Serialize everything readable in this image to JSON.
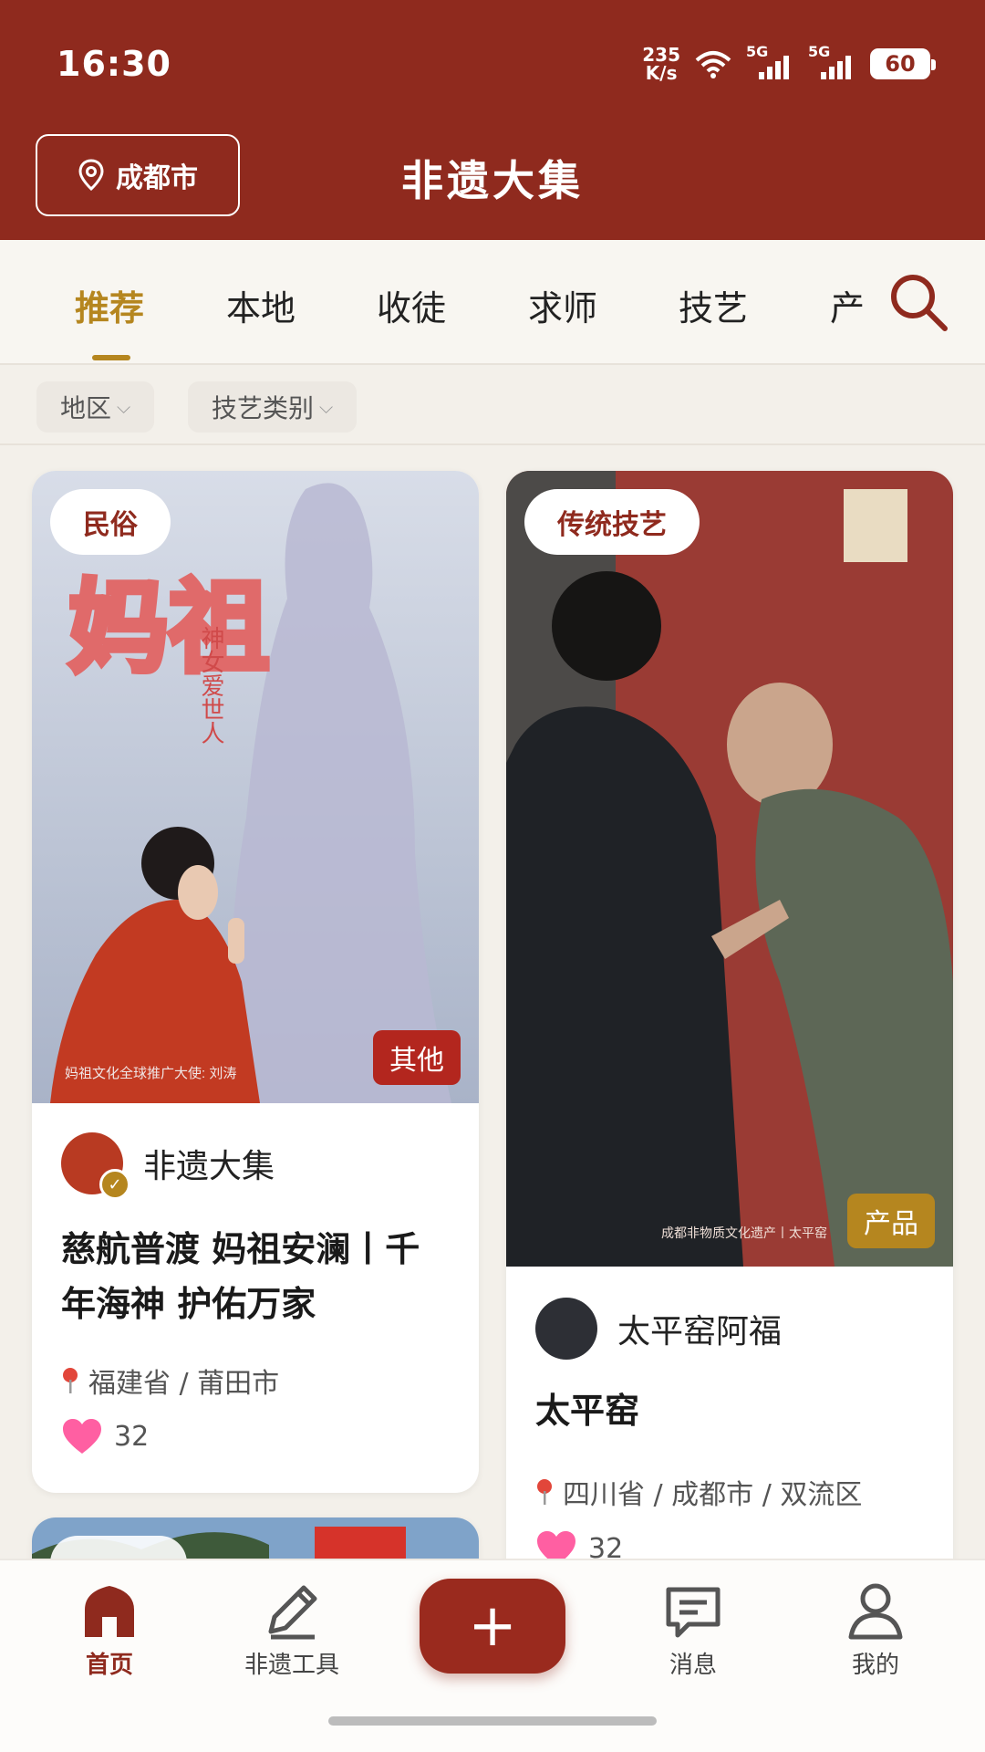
{
  "status_bar": {
    "time": "16:30",
    "net_speed_value": "235",
    "net_speed_unit": "K/s",
    "sig1": "5G",
    "sig2": "5G",
    "battery": "60"
  },
  "header": {
    "city": "成都市",
    "title": "非遗大集"
  },
  "tabs": [
    {
      "label": "推荐",
      "active": true
    },
    {
      "label": "本地"
    },
    {
      "label": "收徒"
    },
    {
      "label": "求师"
    },
    {
      "label": "技艺"
    },
    {
      "label": "产"
    }
  ],
  "filters": [
    {
      "label": "地区"
    },
    {
      "label": "技艺类别"
    }
  ],
  "cards": [
    {
      "tag": "民俗",
      "image_text_title": "妈祖",
      "image_text_vertical": "神女爱世人",
      "image_caption": "妈祖文化全球推广大使: 刘涛",
      "type_badge": "其他",
      "author": "非遗大集",
      "title": "慈航普渡 妈祖安澜丨千年海神 护佑万家",
      "location": "福建省 / 莆田市",
      "likes": "32"
    },
    {
      "tag": "传统技艺",
      "image_caption": "成都非物质文化遗产丨太平窑",
      "type_badge": "产品",
      "author": "太平窑阿福",
      "title": "太平窑",
      "location": "四川省 / 成都市 / 双流区",
      "likes": "32"
    }
  ],
  "bottom_nav": [
    {
      "label": "首页",
      "icon": "home-icon",
      "active": true
    },
    {
      "label": "非遗工具",
      "icon": "pencil-icon"
    },
    {
      "label": "+",
      "icon": "plus-icon"
    },
    {
      "label": "消息",
      "icon": "message-icon"
    },
    {
      "label": "我的",
      "icon": "user-icon"
    }
  ],
  "colors": {
    "brand": "#8f2a1e",
    "accent_gold": "#b5861f",
    "like_pink": "#ff5fa2"
  }
}
